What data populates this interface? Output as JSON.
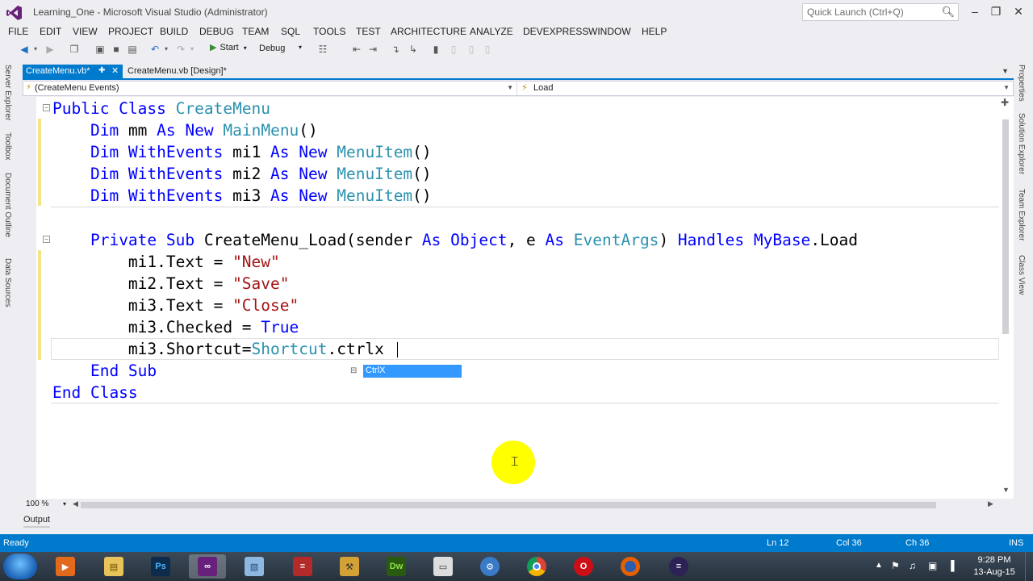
{
  "window": {
    "title": "Learning_One - Microsoft Visual Studio (Administrator)",
    "quick_launch_placeholder": "Quick Launch (Ctrl+Q)"
  },
  "menu": [
    "FILE",
    "EDIT",
    "VIEW",
    "PROJECT",
    "BUILD",
    "DEBUG",
    "TEAM",
    "SQL",
    "TOOLS",
    "TEST",
    "ARCHITECTURE",
    "ANALYZE",
    "DEVEXPRESS",
    "WINDOW",
    "HELP"
  ],
  "toolbar": {
    "start_label": "Start",
    "config_value": "Debug"
  },
  "left_panels": [
    "Server Explorer",
    "Toolbox",
    "Document Outline",
    "Data Sources"
  ],
  "right_panels": [
    "Properties",
    "Solution Explorer",
    "Team Explorer",
    "Class View"
  ],
  "tabs": {
    "active": "CreateMenu.vb*",
    "inactive": "CreateMenu.vb [Design]*"
  },
  "nav": {
    "left": "(CreateMenu Events)",
    "right": "Load"
  },
  "code_lines": [
    "Public Class CreateMenu",
    "    Dim mm As New MainMenu()",
    "    Dim WithEvents mi1 As New MenuItem()",
    "    Dim WithEvents mi2 As New MenuItem()",
    "    Dim WithEvents mi3 As New MenuItem()",
    "",
    "    Private Sub CreateMenu_Load(sender As Object, e As EventArgs) Handles MyBase.Load",
    "        mi1.Text = \"New\"",
    "        mi2.Text = \"Save\"",
    "        mi3.Text = \"Close\"",
    "        mi3.Checked = True",
    "        mi3.Shortcut=Shortcut.ctrlx",
    "    End Sub",
    "End Class"
  ],
  "intellisense": {
    "item": "CtrlX"
  },
  "zoom": "100 %",
  "output_tab": "Output",
  "status": {
    "state": "Ready",
    "line": "Ln 12",
    "col": "Col 36",
    "ch": "Ch 36",
    "mode": "INS"
  },
  "taskbar": {
    "time": "9:28 PM",
    "date": "13-Aug-15",
    "apps": [
      "Media Player",
      "File Explorer",
      "Photoshop",
      "Visual Studio",
      "Virtual Box",
      "WinRAR",
      "Tools",
      "Dreamweaver",
      "Window",
      "Network",
      "Chrome",
      "Opera",
      "Firefox",
      "Eclipse"
    ]
  },
  "colors": {
    "accent": "#007acc",
    "keyword": "#0000ff",
    "type": "#2b91af",
    "string": "#a31515",
    "cursor_highlight": "#ffff00"
  }
}
